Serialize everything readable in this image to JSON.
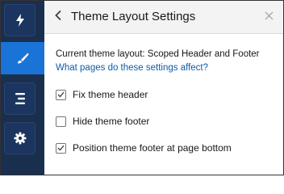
{
  "rail": {
    "items": [
      {
        "icon": "lightning-icon",
        "active": false
      },
      {
        "icon": "paintbrush-icon",
        "active": true
      },
      {
        "icon": "list-icon",
        "active": false
      },
      {
        "icon": "gear-icon",
        "active": false
      }
    ]
  },
  "panel": {
    "title": "Theme Layout Settings",
    "back_icon": "chevron-left-icon",
    "close_icon": "close-icon",
    "current_layout": "Current theme layout: Scoped Header and Footer",
    "help_link": "What pages do these settings affect?",
    "options": [
      {
        "label": "Fix theme header",
        "checked": true
      },
      {
        "label": "Hide theme footer",
        "checked": false
      },
      {
        "label": "Position theme footer at page bottom",
        "checked": true
      }
    ]
  },
  "colors": {
    "rail_bg": "#1a2f4d",
    "rail_button": "#1b3560",
    "active_accent": "#1a73d6",
    "link": "#0b5cab",
    "header_bg": "#f3f3f3"
  }
}
